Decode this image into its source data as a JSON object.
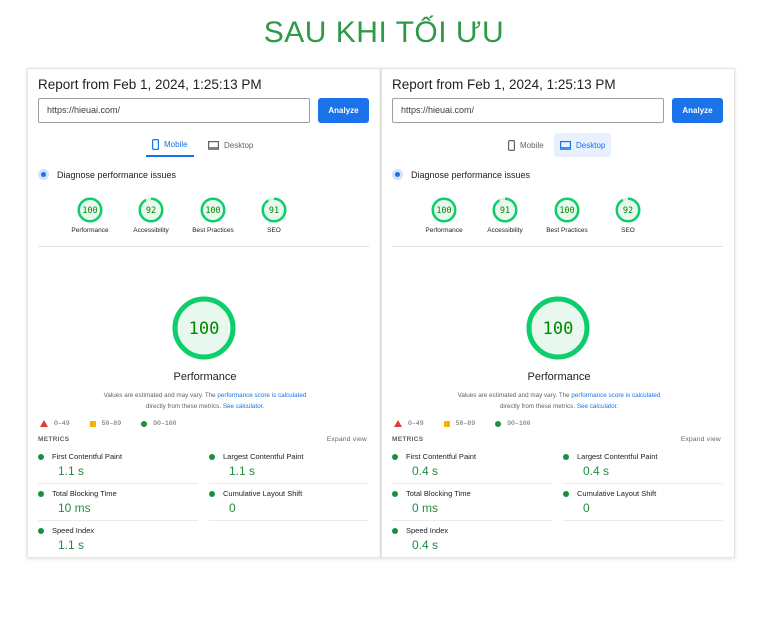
{
  "heading": "SAU KHI TỐI ƯU",
  "panels": [
    {
      "report_title": "Report from Feb 1, 2024, 1:25:13 PM",
      "url": "https://hieuai.com/",
      "analyze_label": "Analyze",
      "tabs": {
        "mobile": "Mobile",
        "desktop": "Desktop",
        "active": "mobile"
      },
      "diagnose_label": "Diagnose performance issues",
      "scores": [
        {
          "value": "100",
          "label": "Performance",
          "fraction": 1.0
        },
        {
          "value": "92",
          "label": "Accessibility",
          "fraction": 0.92
        },
        {
          "value": "100",
          "label": "Best Practices",
          "fraction": 1.0
        },
        {
          "value": "91",
          "label": "SEO",
          "fraction": 0.91
        }
      ],
      "main_score": {
        "value": "100",
        "label": "Performance",
        "fraction": 1.0
      },
      "note": {
        "line1": "Values are estimated and may vary. The ",
        "link1": "performance score is calculated",
        "line2": "directly from these metrics. ",
        "link2": "See calculator."
      },
      "legend": {
        "bad": "0–49",
        "avg": "50–89",
        "good": "90–100"
      },
      "metrics_header": "METRICS",
      "expand_label": "Expand view",
      "metrics": [
        {
          "name": "First Contentful Paint",
          "value": "1.1 s"
        },
        {
          "name": "Largest Contentful Paint",
          "value": "1.1 s"
        },
        {
          "name": "Total Blocking Time",
          "value": "10 ms"
        },
        {
          "name": "Cumulative Layout Shift",
          "value": "0"
        },
        {
          "name": "Speed Index",
          "value": "1.1 s"
        }
      ]
    },
    {
      "report_title": "Report from Feb 1, 2024, 1:25:13 PM",
      "url": "https://hieuai.com/",
      "analyze_label": "Analyze",
      "tabs": {
        "mobile": "Mobile",
        "desktop": "Desktop",
        "active": "desktop"
      },
      "diagnose_label": "Diagnose performance issues",
      "scores": [
        {
          "value": "100",
          "label": "Performance",
          "fraction": 1.0
        },
        {
          "value": "91",
          "label": "Accessibility",
          "fraction": 0.91
        },
        {
          "value": "100",
          "label": "Best Practices",
          "fraction": 1.0
        },
        {
          "value": "92",
          "label": "SEO",
          "fraction": 0.92
        }
      ],
      "main_score": {
        "value": "100",
        "label": "Performance",
        "fraction": 1.0
      },
      "note": {
        "line1": "Values are estimated and may vary. The ",
        "link1": "performance score is calculated",
        "line2": "directly from these metrics. ",
        "link2": "See calculator."
      },
      "legend": {
        "bad": "0–49",
        "avg": "50–89",
        "good": "90–100"
      },
      "metrics_header": "METRICS",
      "expand_label": "Expand view",
      "metrics": [
        {
          "name": "First Contentful Paint",
          "value": "0.4 s"
        },
        {
          "name": "Largest Contentful Paint",
          "value": "0.4 s"
        },
        {
          "name": "Total Blocking Time",
          "value": "0 ms"
        },
        {
          "name": "Cumulative Layout Shift",
          "value": "0"
        },
        {
          "name": "Speed Index",
          "value": "0.4 s"
        }
      ]
    }
  ],
  "colors": {
    "good": "#0cce6b",
    "good_text": "#1e8e3e",
    "accent": "#1a73e8",
    "heading": "#2e9a47"
  }
}
